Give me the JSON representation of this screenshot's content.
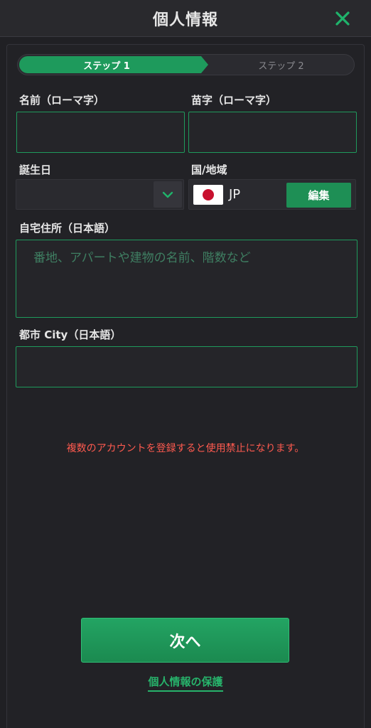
{
  "header": {
    "title": "個人情報"
  },
  "stepper": {
    "step1": "ステップ 1",
    "step2": "ステップ 2"
  },
  "form": {
    "first_name_label": "名前（ローマ字）",
    "first_name_value": "",
    "last_name_label": "苗字（ローマ字）",
    "last_name_value": "",
    "dob_label": "誕生日",
    "dob_value": "",
    "country_label": "国/地域",
    "country_code": "JP",
    "edit_label": "編集",
    "address_label": "自宅住所（日本語）",
    "address_placeholder": "番地、アパートや建物の名前、階数など",
    "address_value": "",
    "city_label": "都市 City（日本語）",
    "city_value": ""
  },
  "warning": "複数のアカウントを登録すると使用禁止になります。",
  "next_label": "次へ",
  "privacy_label": "個人情報の保護",
  "colors": {
    "accent": "#1e9a5c",
    "warning": "#ff5a4f",
    "background": "#202024"
  }
}
